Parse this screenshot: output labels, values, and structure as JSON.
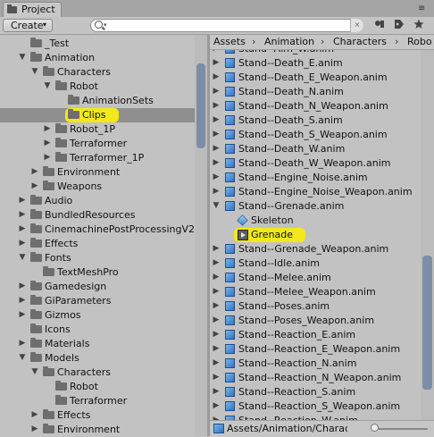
{
  "window": {
    "tab_label": "Project",
    "menu_icon": "≡"
  },
  "toolbar": {
    "create_label": "Create",
    "create_arrow": "▾",
    "search_value": "",
    "search_dropdown": "▾",
    "search_clear": "×",
    "buttons": [
      "lock-icon",
      "label-icon",
      "star-icon"
    ]
  },
  "left_tree": [
    {
      "label": "_Test",
      "indent": 1,
      "arrow": "",
      "kind": "folder"
    },
    {
      "label": "Animation",
      "indent": 1,
      "arrow": "▼",
      "kind": "folder"
    },
    {
      "label": "Characters",
      "indent": 2,
      "arrow": "▼",
      "kind": "folder"
    },
    {
      "label": "Robot",
      "indent": 3,
      "arrow": "▼",
      "kind": "folder"
    },
    {
      "label": "AnimationSets",
      "indent": 4,
      "arrow": "",
      "kind": "folder"
    },
    {
      "label": "Clips",
      "indent": 4,
      "arrow": "",
      "kind": "folder",
      "selected": true,
      "highlight": true
    },
    {
      "label": "Robot_1P",
      "indent": 3,
      "arrow": "▶",
      "kind": "folder"
    },
    {
      "label": "Terraformer",
      "indent": 3,
      "arrow": "▶",
      "kind": "folder"
    },
    {
      "label": "Terraformer_1P",
      "indent": 3,
      "arrow": "▶",
      "kind": "folder"
    },
    {
      "label": "Environment",
      "indent": 2,
      "arrow": "▶",
      "kind": "folder"
    },
    {
      "label": "Weapons",
      "indent": 2,
      "arrow": "▶",
      "kind": "folder"
    },
    {
      "label": "Audio",
      "indent": 1,
      "arrow": "▶",
      "kind": "folder"
    },
    {
      "label": "BundledResources",
      "indent": 1,
      "arrow": "▶",
      "kind": "folder"
    },
    {
      "label": "CinemachinePostProcessingV2",
      "indent": 1,
      "arrow": "▶",
      "kind": "folder"
    },
    {
      "label": "Effects",
      "indent": 1,
      "arrow": "▶",
      "kind": "folder"
    },
    {
      "label": "Fonts",
      "indent": 1,
      "arrow": "▼",
      "kind": "folder"
    },
    {
      "label": "TextMeshPro",
      "indent": 2,
      "arrow": "",
      "kind": "folder"
    },
    {
      "label": "Gamedesign",
      "indent": 1,
      "arrow": "▶",
      "kind": "folder"
    },
    {
      "label": "GiParameters",
      "indent": 1,
      "arrow": "▶",
      "kind": "folder"
    },
    {
      "label": "Gizmos",
      "indent": 1,
      "arrow": "▶",
      "kind": "folder"
    },
    {
      "label": "Icons",
      "indent": 1,
      "arrow": "",
      "kind": "folder"
    },
    {
      "label": "Materials",
      "indent": 1,
      "arrow": "▶",
      "kind": "folder"
    },
    {
      "label": "Models",
      "indent": 1,
      "arrow": "▼",
      "kind": "folder"
    },
    {
      "label": "Characters",
      "indent": 2,
      "arrow": "▼",
      "kind": "folder"
    },
    {
      "label": "Robot",
      "indent": 3,
      "arrow": "",
      "kind": "folder"
    },
    {
      "label": "Terraformer",
      "indent": 3,
      "arrow": "",
      "kind": "folder"
    },
    {
      "label": "Effects",
      "indent": 2,
      "arrow": "▶",
      "kind": "folder"
    },
    {
      "label": "Environment",
      "indent": 2,
      "arrow": "▶",
      "kind": "folder"
    }
  ],
  "breadcrumb": [
    "Assets",
    "Animation",
    "Characters",
    "Robo"
  ],
  "breadcrumb_sep": "›",
  "right_list": [
    {
      "label": "Stand--Aim_W.anim",
      "arrow": "▶",
      "kind": "anim",
      "indent": 0
    },
    {
      "label": "Stand--Death_E.anim",
      "arrow": "▶",
      "kind": "anim",
      "indent": 0
    },
    {
      "label": "Stand--Death_E_Weapon.anim",
      "arrow": "▶",
      "kind": "anim",
      "indent": 0
    },
    {
      "label": "Stand--Death_N.anim",
      "arrow": "▶",
      "kind": "anim",
      "indent": 0
    },
    {
      "label": "Stand--Death_N_Weapon.anim",
      "arrow": "▶",
      "kind": "anim",
      "indent": 0
    },
    {
      "label": "Stand--Death_S.anim",
      "arrow": "▶",
      "kind": "anim",
      "indent": 0
    },
    {
      "label": "Stand--Death_S_Weapon.anim",
      "arrow": "▶",
      "kind": "anim",
      "indent": 0
    },
    {
      "label": "Stand--Death_W.anim",
      "arrow": "▶",
      "kind": "anim",
      "indent": 0
    },
    {
      "label": "Stand--Death_W_Weapon.anim",
      "arrow": "▶",
      "kind": "anim",
      "indent": 0
    },
    {
      "label": "Stand--Engine_Noise.anim",
      "arrow": "▶",
      "kind": "anim",
      "indent": 0
    },
    {
      "label": "Stand--Engine_Noise_Weapon.anim",
      "arrow": "▶",
      "kind": "anim",
      "indent": 0
    },
    {
      "label": "Stand--Grenade.anim",
      "arrow": "▼",
      "kind": "anim",
      "indent": 0
    },
    {
      "label": "Skeleton",
      "arrow": "",
      "kind": "skeleton",
      "indent": 1
    },
    {
      "label": "Grenade",
      "arrow": "",
      "kind": "clip",
      "indent": 1,
      "highlight": true
    },
    {
      "label": "Stand--Grenade_Weapon.anim",
      "arrow": "▶",
      "kind": "anim",
      "indent": 0
    },
    {
      "label": "Stand--Idle.anim",
      "arrow": "▶",
      "kind": "anim",
      "indent": 0
    },
    {
      "label": "Stand--Melee.anim",
      "arrow": "▶",
      "kind": "anim",
      "indent": 0
    },
    {
      "label": "Stand--Melee_Weapon.anim",
      "arrow": "▶",
      "kind": "anim",
      "indent": 0
    },
    {
      "label": "Stand--Poses.anim",
      "arrow": "▶",
      "kind": "anim",
      "indent": 0
    },
    {
      "label": "Stand--Poses_Weapon.anim",
      "arrow": "▶",
      "kind": "anim",
      "indent": 0
    },
    {
      "label": "Stand--Reaction_E.anim",
      "arrow": "▶",
      "kind": "anim",
      "indent": 0
    },
    {
      "label": "Stand--Reaction_E_Weapon.anim",
      "arrow": "▶",
      "kind": "anim",
      "indent": 0
    },
    {
      "label": "Stand--Reaction_N.anim",
      "arrow": "▶",
      "kind": "anim",
      "indent": 0
    },
    {
      "label": "Stand--Reaction_N_Weapon.anim",
      "arrow": "▶",
      "kind": "anim",
      "indent": 0
    },
    {
      "label": "Stand--Reaction_S.anim",
      "arrow": "▶",
      "kind": "anim",
      "indent": 0
    },
    {
      "label": "Stand--Reaction_S_Weapon.anim",
      "arrow": "▶",
      "kind": "anim",
      "indent": 0
    },
    {
      "label": "Stand--Reaction_W.anim",
      "arrow": "▶",
      "kind": "anim",
      "indent": 0
    }
  ],
  "status": {
    "path": "Assets/Animation/Characte"
  },
  "colors": {
    "highlight": "#f2e81a",
    "selection": "#8f8f8f",
    "scroll_thumb": "#7c8da8",
    "anim_icon": "#2f73c5"
  }
}
